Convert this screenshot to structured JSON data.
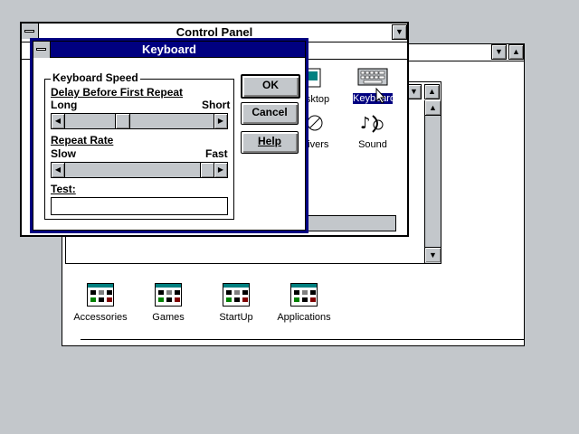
{
  "program_manager": {
    "groups": [
      {
        "label": "Accessories"
      },
      {
        "label": "Games"
      },
      {
        "label": "StartUp"
      },
      {
        "label": "Applications"
      }
    ]
  },
  "control_panel": {
    "title": "Control Panel",
    "icons": [
      {
        "label": "Desktop"
      },
      {
        "label": "Keyboard"
      },
      {
        "label": "Drivers"
      },
      {
        "label": "Sound"
      }
    ]
  },
  "keyboard_dialog": {
    "title": "Keyboard",
    "group_title": "Keyboard Speed",
    "delay": {
      "label": "Delay Before First Repeat",
      "min_label": "Long",
      "max_label": "Short",
      "value_fraction": 0.37
    },
    "repeat": {
      "label": "Repeat Rate",
      "min_label": "Slow",
      "max_label": "Fast",
      "value_fraction": 1.0
    },
    "test": {
      "label": "Test:",
      "value": ""
    },
    "buttons": {
      "ok": "OK",
      "cancel": "Cancel",
      "help": "Help"
    }
  },
  "colors": {
    "desktop": "#c3c7cb",
    "title_active": "#000080",
    "window_bg": "#ffffff",
    "selection": "#000080"
  }
}
